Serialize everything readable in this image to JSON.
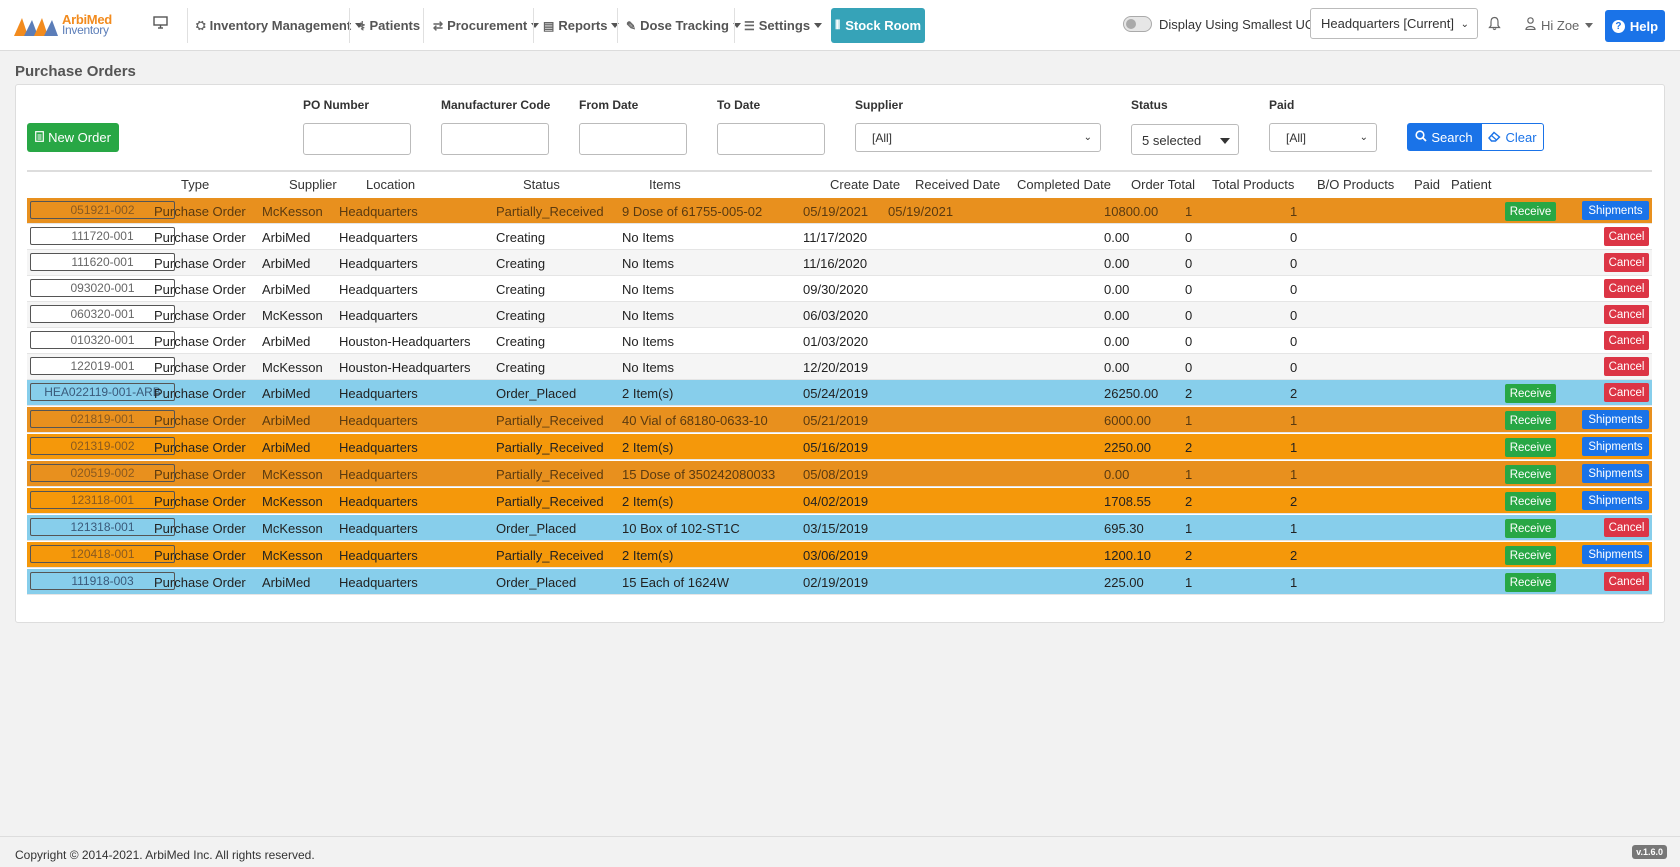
{
  "navbar": {
    "logo_line1": "ArbiMed",
    "logo_line2": "Inventory",
    "items": [
      {
        "label": "Inventory Management",
        "icon": "cubes-icon"
      },
      {
        "label": "Patients",
        "icon": "user-injured-icon"
      },
      {
        "label": "Procurement",
        "icon": "exchange-icon"
      },
      {
        "label": "Reports",
        "icon": "file-icon"
      },
      {
        "label": "Dose Tracking",
        "icon": "syringe-icon"
      },
      {
        "label": "Settings",
        "icon": "sliders-icon"
      }
    ],
    "stock_room": "Stock Room",
    "toggle_label": "Display Using Smallest UOM",
    "location": "Headquarters [Current]",
    "user": "Hi Zoe",
    "help": "Help"
  },
  "page": {
    "title": "Purchase Orders"
  },
  "filters": {
    "new_order": "New Order",
    "po_number_label": "PO Number",
    "manufacturer_code_label": "Manufacturer Code",
    "from_date_label": "From Date",
    "to_date_label": "To Date",
    "supplier_label": "Supplier",
    "supplier_value": "[All]",
    "status_label": "Status",
    "status_value": "5 selected",
    "paid_label": "Paid",
    "paid_value": "[All]",
    "search": "Search",
    "clear": "Clear"
  },
  "table": {
    "headers": [
      "Type",
      "Supplier",
      "Location",
      "Status",
      "Items",
      "Create Date",
      "Received Date",
      "Completed Date",
      "Order Total",
      "Total Products",
      "B/O Products",
      "Paid",
      "Patient"
    ],
    "rows": [
      {
        "po": "051921-002",
        "type": "Purchase Order",
        "supplier": "McKesson",
        "location": "Headquarters",
        "status": "Partially_Received",
        "items": "9 Dose of 61755-005-02",
        "create": "05/19/2021",
        "received": "05/19/2021",
        "completed": "",
        "total": "10800.00",
        "products": "1",
        "bo": "1",
        "paid": "",
        "patient": "",
        "receive": "Receive",
        "action": "Shipments",
        "color": "#e8901e"
      },
      {
        "po": "111720-001",
        "type": "Purchase Order",
        "supplier": "ArbiMed",
        "location": "Headquarters",
        "status": "Creating",
        "items": "No Items",
        "create": "11/17/2020",
        "received": "",
        "completed": "",
        "total": "0.00",
        "products": "0",
        "bo": "0",
        "paid": "",
        "patient": "",
        "receive": "",
        "action": "Cancel",
        "color": "#ffffff"
      },
      {
        "po": "111620-001",
        "type": "Purchase Order",
        "supplier": "ArbiMed",
        "location": "Headquarters",
        "status": "Creating",
        "items": "No Items",
        "create": "11/16/2020",
        "received": "",
        "completed": "",
        "total": "0.00",
        "products": "0",
        "bo": "0",
        "paid": "",
        "patient": "",
        "receive": "",
        "action": "Cancel",
        "color": "#f5f5f5"
      },
      {
        "po": "093020-001",
        "type": "Purchase Order",
        "supplier": "ArbiMed",
        "location": "Headquarters",
        "status": "Creating",
        "items": "No Items",
        "create": "09/30/2020",
        "received": "",
        "completed": "",
        "total": "0.00",
        "products": "0",
        "bo": "0",
        "paid": "",
        "patient": "",
        "receive": "",
        "action": "Cancel",
        "color": "#ffffff"
      },
      {
        "po": "060320-001",
        "type": "Purchase Order",
        "supplier": "McKesson",
        "location": "Headquarters",
        "status": "Creating",
        "items": "No Items",
        "create": "06/03/2020",
        "received": "",
        "completed": "",
        "total": "0.00",
        "products": "0",
        "bo": "0",
        "paid": "",
        "patient": "",
        "receive": "",
        "action": "Cancel",
        "color": "#f5f5f5"
      },
      {
        "po": "010320-001",
        "type": "Purchase Order",
        "supplier": "ArbiMed",
        "location": "Houston-Headquarters",
        "status": "Creating",
        "items": "No Items",
        "create": "01/03/2020",
        "received": "",
        "completed": "",
        "total": "0.00",
        "products": "0",
        "bo": "0",
        "paid": "",
        "patient": "",
        "receive": "",
        "action": "Cancel",
        "color": "#ffffff"
      },
      {
        "po": "122019-001",
        "type": "Purchase Order",
        "supplier": "McKesson",
        "location": "Houston-Headquarters",
        "status": "Creating",
        "items": "No Items",
        "create": "12/20/2019",
        "received": "",
        "completed": "",
        "total": "0.00",
        "products": "0",
        "bo": "0",
        "paid": "",
        "patient": "",
        "receive": "",
        "action": "Cancel",
        "color": "#f5f5f5"
      },
      {
        "po": "HEA022119-001-ARB",
        "type": "Purchase Order",
        "supplier": "ArbiMed",
        "location": "Headquarters",
        "status": "Order_Placed",
        "items": "2 Item(s)",
        "create": "05/24/2019",
        "received": "",
        "completed": "",
        "total": "26250.00",
        "products": "2",
        "bo": "2",
        "paid": "",
        "patient": "",
        "receive": "Receive",
        "action": "Cancel",
        "color": "#87ceeb"
      },
      {
        "po": "021819-001",
        "type": "Purchase Order",
        "supplier": "ArbiMed",
        "location": "Headquarters",
        "status": "Partially_Received",
        "items": "40 Vial of 68180-0633-10",
        "create": "05/21/2019",
        "received": "",
        "completed": "",
        "total": "6000.00",
        "products": "1",
        "bo": "1",
        "paid": "",
        "patient": "",
        "receive": "Receive",
        "action": "Shipments",
        "color": "#e8901e"
      },
      {
        "po": "021319-002",
        "type": "Purchase Order",
        "supplier": "ArbiMed",
        "location": "Headquarters",
        "status": "Partially_Received",
        "items": "2 Item(s)",
        "create": "05/16/2019",
        "received": "",
        "completed": "",
        "total": "2250.00",
        "products": "2",
        "bo": "1",
        "paid": "",
        "patient": "",
        "receive": "Receive",
        "action": "Shipments",
        "color": "#f5980a"
      },
      {
        "po": "020519-002",
        "type": "Purchase Order",
        "supplier": "McKesson",
        "location": "Headquarters",
        "status": "Partially_Received",
        "items": "15 Dose of 350242080033",
        "create": "05/08/2019",
        "received": "",
        "completed": "",
        "total": "0.00",
        "products": "1",
        "bo": "1",
        "paid": "",
        "patient": "",
        "receive": "Receive",
        "action": "Shipments",
        "color": "#e8901e"
      },
      {
        "po": "123118-001",
        "type": "Purchase Order",
        "supplier": "McKesson",
        "location": "Headquarters",
        "status": "Partially_Received",
        "items": "2 Item(s)",
        "create": "04/02/2019",
        "received": "",
        "completed": "",
        "total": "1708.55",
        "products": "2",
        "bo": "2",
        "paid": "",
        "patient": "",
        "receive": "Receive",
        "action": "Shipments",
        "color": "#f5980a"
      },
      {
        "po": "121318-001",
        "type": "Purchase Order",
        "supplier": "McKesson",
        "location": "Headquarters",
        "status": "Order_Placed",
        "items": "10 Box of 102-ST1C",
        "create": "03/15/2019",
        "received": "",
        "completed": "",
        "total": "695.30",
        "products": "1",
        "bo": "1",
        "paid": "",
        "patient": "",
        "receive": "Receive",
        "action": "Cancel",
        "color": "#87ceeb"
      },
      {
        "po": "120418-001",
        "type": "Purchase Order",
        "supplier": "McKesson",
        "location": "Headquarters",
        "status": "Partially_Received",
        "items": "2 Item(s)",
        "create": "03/06/2019",
        "received": "",
        "completed": "",
        "total": "1200.10",
        "products": "2",
        "bo": "2",
        "paid": "",
        "patient": "",
        "receive": "Receive",
        "action": "Shipments",
        "color": "#f5980a"
      },
      {
        "po": "111918-003",
        "type": "Purchase Order",
        "supplier": "ArbiMed",
        "location": "Headquarters",
        "status": "Order_Placed",
        "items": "15 Each of 1624W",
        "create": "02/19/2019",
        "received": "",
        "completed": "",
        "total": "225.00",
        "products": "1",
        "bo": "1",
        "paid": "",
        "patient": "",
        "receive": "Receive",
        "action": "Cancel",
        "color": "#87ceeb"
      }
    ]
  },
  "footer": {
    "copyright": "Copyright © 2014-2021. ArbiMed Inc. All rights reserved.",
    "version": "v.1.6.0"
  }
}
